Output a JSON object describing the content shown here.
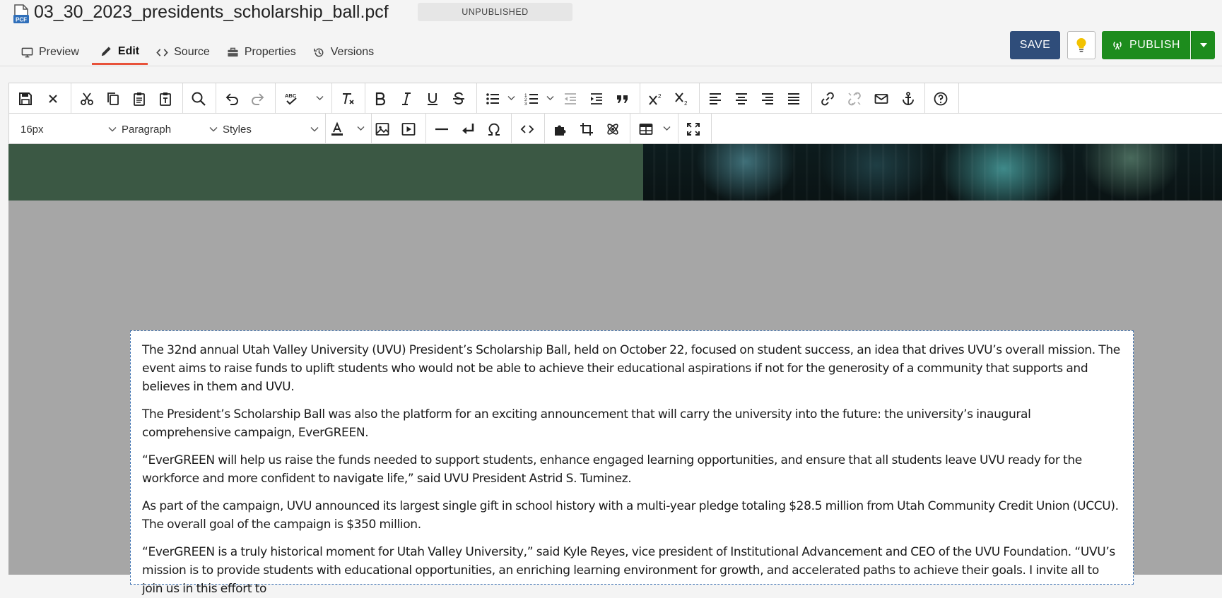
{
  "header": {
    "file_name": "03_30_2023_presidents_scholarship_ball.pcf",
    "status": "UNPUBLISHED",
    "file_icon_label": "PCF",
    "tabs": [
      {
        "label": "Preview",
        "icon": "monitor-icon"
      },
      {
        "label": "Edit",
        "icon": "pencil-icon",
        "active": true
      },
      {
        "label": "Source",
        "icon": "code-icon"
      },
      {
        "label": "Properties",
        "icon": "briefcase-icon"
      },
      {
        "label": "Versions",
        "icon": "history-icon"
      }
    ],
    "save_label": "SAVE",
    "publish_label": "PUBLISH"
  },
  "toolbar": {
    "font_size": "16px",
    "block_format": "Paragraph",
    "styles": "Styles",
    "row1_icons": [
      "save-icon",
      "close-icon",
      "cut-icon",
      "copy-icon",
      "paste-icon",
      "paste-text-icon",
      "find-icon",
      "undo-icon",
      "redo-icon",
      "spellcheck-icon",
      "clear-format-icon",
      "bold-icon",
      "italic-icon",
      "underline-icon",
      "strikethrough-icon",
      "bullet-list-icon",
      "numbered-list-icon",
      "outdent-icon",
      "indent-icon",
      "blockquote-icon",
      "superscript-icon",
      "subscript-icon",
      "align-left-icon",
      "align-center-icon",
      "align-right-icon",
      "justify-icon",
      "link-icon",
      "unlink-icon",
      "email-icon",
      "anchor-icon",
      "help-icon"
    ],
    "row2_icons": [
      "text-color-icon",
      "image-icon",
      "media-icon",
      "horizontal-rule-icon",
      "line-break-icon",
      "special-char-icon",
      "source-code-icon",
      "plugin-icon",
      "crop-icon",
      "component-icon",
      "table-icon",
      "fullscreen-icon"
    ]
  },
  "colors": {
    "save_button": "#2f4d7a",
    "publish_button": "#1d8c1d",
    "active_tab_underline": "#e8523a",
    "banner_green": "#3b5844",
    "canvas_gray": "#a6a6a6"
  },
  "content": {
    "paragraphs": [
      "The 32nd annual Utah Valley University (UVU) President’s Scholarship Ball, held on October 22, focused on student success, an idea that drives UVU’s overall mission. The event aims to raise funds to uplift students who would not be able to achieve their educational aspirations if not for the generosity of a community that supports and believes in them and UVU.",
      "The President’s Scholarship Ball was also the platform for an exciting announcement that will carry the university into the future: the university’s inaugural comprehensive campaign, EverGREEN.",
      "“EverGREEN will help us raise the funds needed to support students, enhance engaged learning opportunities, and ensure that all students leave UVU ready for the workforce and more confident to navigate life,” said UVU President Astrid S. Tuminez.",
      "As part of the campaign, UVU announced its largest single gift in school history with a multi-year pledge totaling $28.5 million from Utah Community Credit Union (UCCU). The overall goal of the campaign is $350 million.",
      "“EverGREEN is a truly historical moment for Utah Valley University,” said Kyle Reyes, vice president of Institutional Advancement and CEO of the UVU Foundation. “UVU’s mission is to provide students with educational opportunities, an enriching learning environment for growth, and accelerated paths to achieve their goals. I invite all to join us in this effort to"
    ]
  }
}
